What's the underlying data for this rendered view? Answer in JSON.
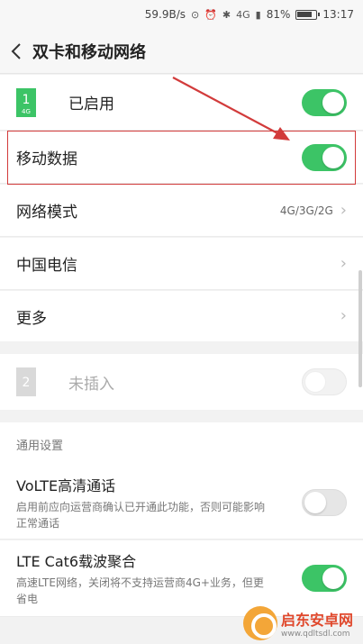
{
  "status_bar": {
    "speed": "59.9B/s",
    "network": "4G",
    "battery": "81%",
    "time": "13:17"
  },
  "header": {
    "title": "双卡和移动网络"
  },
  "sim1": {
    "badge_number": "1",
    "badge_sub": "4G",
    "status": "已启用",
    "enabled": true
  },
  "mobile_data": {
    "label": "移动数据",
    "enabled": true
  },
  "network_mode": {
    "label": "网络模式",
    "value": "4G/3G/2G"
  },
  "carrier": {
    "label": "中国电信"
  },
  "more": {
    "label": "更多"
  },
  "sim2": {
    "badge_number": "2",
    "status": "未插入",
    "enabled": false
  },
  "general": {
    "title": "通用设置",
    "volte": {
      "label": "VoLTE高清通话",
      "desc": "启用前应向运营商确认已开通此功能，否则可能影响正常通话",
      "enabled": false
    },
    "lte": {
      "label": "LTE Cat6载波聚合",
      "desc": "高速LTE网络，关闭将不支持运营商4G+业务，但更省电",
      "enabled": true
    }
  },
  "watermark": {
    "name": "启东安卓网",
    "url": "www.qdltsdl.com"
  },
  "colors": {
    "toggle_on": "#3cc466",
    "highlight": "#d23b3b"
  }
}
